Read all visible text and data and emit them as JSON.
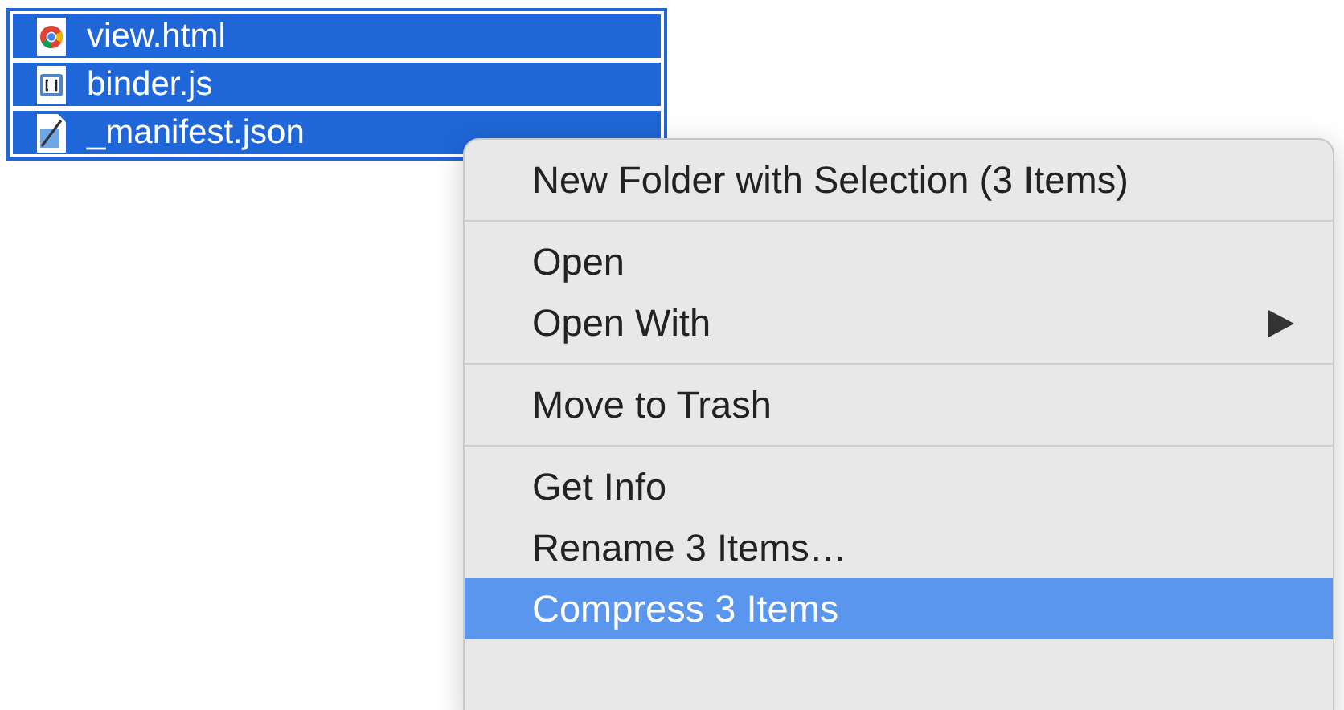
{
  "files": [
    {
      "name": "view.html",
      "kind": "web-page",
      "selected": true
    },
    {
      "name": "binder.js",
      "kind": "script",
      "selected": true
    },
    {
      "name": "_manifest.json",
      "kind": "data",
      "selected": true
    }
  ],
  "context_menu": {
    "items": [
      {
        "kind": "item",
        "label": "New Folder with Selection (3 Items)",
        "selected": false,
        "submenu": false
      },
      {
        "kind": "separator"
      },
      {
        "kind": "item",
        "label": "Open",
        "selected": false,
        "submenu": false
      },
      {
        "kind": "item",
        "label": "Open With",
        "selected": false,
        "submenu": true
      },
      {
        "kind": "separator"
      },
      {
        "kind": "item",
        "label": "Move to Trash",
        "selected": false,
        "submenu": false
      },
      {
        "kind": "separator"
      },
      {
        "kind": "item",
        "label": "Get Info",
        "selected": false,
        "submenu": false
      },
      {
        "kind": "item",
        "label": "Rename 3 Items…",
        "selected": false,
        "submenu": false
      },
      {
        "kind": "item",
        "label": "Compress 3 Items",
        "selected": true,
        "submenu": false
      }
    ]
  }
}
